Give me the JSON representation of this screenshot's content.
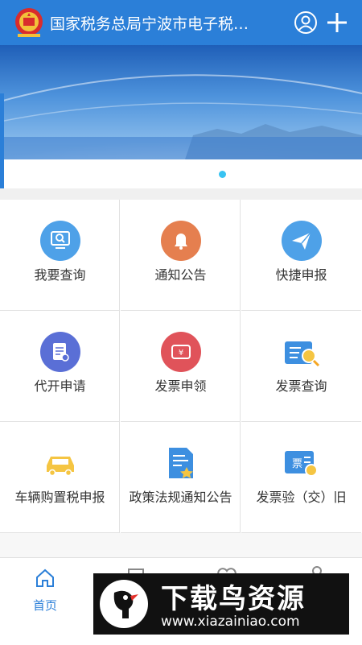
{
  "header": {
    "title": "国家税务总局宁波市电子税…"
  },
  "menu": [
    {
      "label": "我要查询",
      "icon": "search-monitor-icon"
    },
    {
      "label": "通知公告",
      "icon": "bell-icon"
    },
    {
      "label": "快捷申报",
      "icon": "paper-plane-icon"
    },
    {
      "label": "代开申请",
      "icon": "document-edit-icon"
    },
    {
      "label": "发票申领",
      "icon": "ticket-icon"
    },
    {
      "label": "发票查询",
      "icon": "invoice-search-icon"
    },
    {
      "label": "车辆购置税申报",
      "icon": "car-icon"
    },
    {
      "label": "政策法规通知公告",
      "icon": "policy-document-icon"
    },
    {
      "label": "发票验（交）旧",
      "icon": "invoice-verify-icon"
    }
  ],
  "tabs": [
    {
      "label": "首页",
      "icon": "home-icon"
    }
  ],
  "ad": {
    "title": "下载鸟资源",
    "url": "www.xiazainiao.com"
  },
  "colors": {
    "primary": "#2b7fd8",
    "accent": "#38c3f2"
  }
}
